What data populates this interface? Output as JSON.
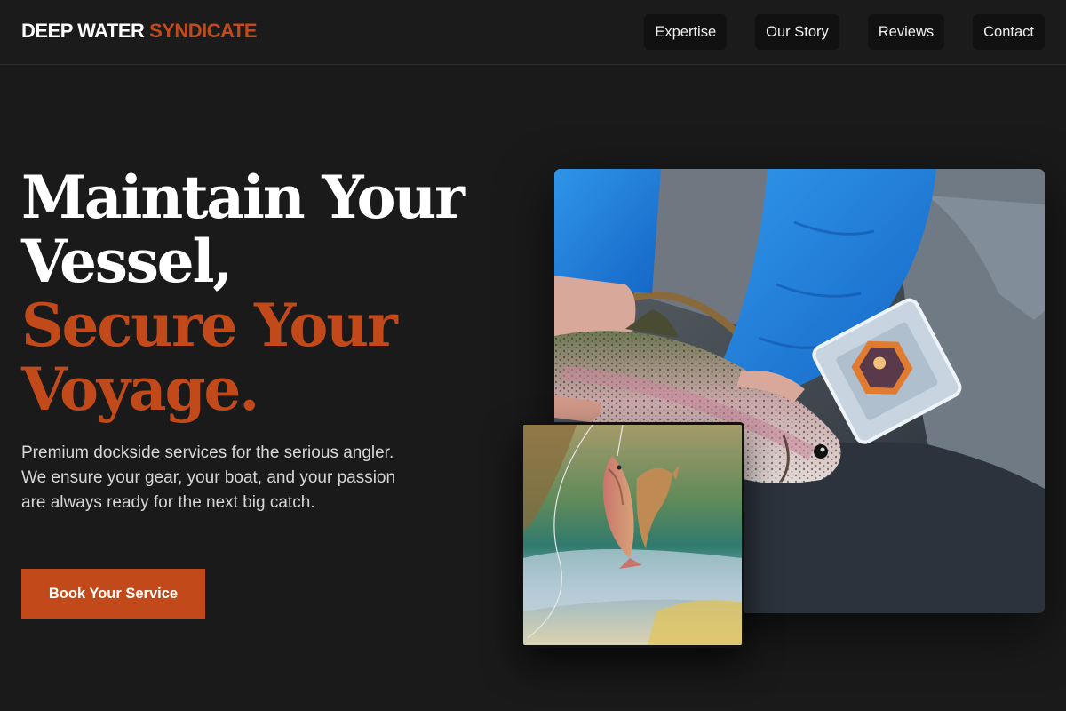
{
  "brand": {
    "name_primary": "DEEP WATER",
    "name_accent": "SYNDICATE"
  },
  "nav": {
    "items": [
      {
        "label": "Expertise"
      },
      {
        "label": "Our Story"
      },
      {
        "label": "Reviews"
      },
      {
        "label": "Contact"
      }
    ]
  },
  "hero": {
    "title_line1": "Maintain Your",
    "title_line2": "Vessel,",
    "title_line3": "Secure Your",
    "title_line4": "Voyage.",
    "description": "Premium dockside services for the serious angler. We ensure your gear, your boat, and your passion are always ready for the next big catch.",
    "cta_label": "Book Your Service"
  },
  "images": {
    "main": "angler-holding-rainbow-trout-photo",
    "inset": "trout-on-fishing-line-photo"
  },
  "colors": {
    "accent": "#c24a1a",
    "background": "#1a1a1b"
  }
}
